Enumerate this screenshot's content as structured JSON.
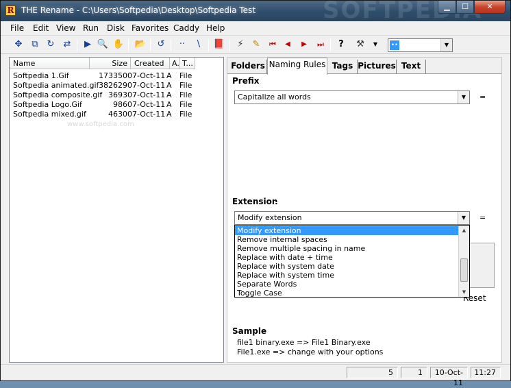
{
  "window": {
    "title": "THE Rename - C:\\Users\\Softpedia\\Desktop\\Softpedia Test",
    "icon_letter": "R",
    "watermark": "SOFTPEDIA",
    "controls": {
      "minimize": "▁",
      "maximize": "☐",
      "close": "✕"
    }
  },
  "menu": [
    "File",
    "Edit",
    "View",
    "Run",
    "Disk",
    "Favorites",
    "Caddy",
    "Help"
  ],
  "toolbar": {
    "icons": [
      "move-icon",
      "copy-icon",
      "refresh-icon",
      "toggle-icon",
      "run-icon",
      "preview-icon",
      "hand-icon",
      "open-folder-icon",
      "undo-icon",
      "dots-icon",
      "slash-icon",
      "book-icon",
      "wand-icon",
      "eraser-icon",
      "first-icon",
      "prev-icon",
      "next-icon",
      "last-icon",
      "help-icon",
      "tools-icon"
    ],
    "glyphs": [
      "✥",
      "⧉",
      "↻",
      "⇄",
      "▶",
      "🔍",
      "✋",
      "📂",
      "↺",
      "··",
      "\\",
      "📕",
      "⚡",
      "✎",
      "⏮",
      "◀",
      "▶",
      "⏭",
      "?",
      "⚒"
    ],
    "combo_swatch": "••"
  },
  "filelist": {
    "columns": [
      "Name",
      "Size",
      "Created",
      "A..",
      "T..."
    ],
    "rows": [
      {
        "name": "Softpedia 1.Gif",
        "size": "173350",
        "created": "07-Oct-11",
        "attr": "A",
        "type": "File"
      },
      {
        "name": "Softpedia animated.gif",
        "size": "382629",
        "created": "07-Oct-11",
        "attr": "A",
        "type": "File"
      },
      {
        "name": "Softpedia composite.gif",
        "size": "3693",
        "created": "07-Oct-11",
        "attr": "A",
        "type": "File"
      },
      {
        "name": "Softpedia Logo.Gif",
        "size": "986",
        "created": "07-Oct-11",
        "attr": "A",
        "type": "File"
      },
      {
        "name": "Softpedia mixed.gif",
        "size": "4630",
        "created": "07-Oct-11",
        "attr": "A",
        "type": "File"
      }
    ],
    "watermark": "www.softpedia.com"
  },
  "tabs": [
    {
      "label": "Folders",
      "active": false
    },
    {
      "label": "Naming Rules",
      "active": true
    },
    {
      "label": "Tags",
      "active": false
    },
    {
      "label": "Pictures",
      "active": false
    },
    {
      "label": "Text",
      "active": false
    }
  ],
  "prefix": {
    "label": "Prefix",
    "value": "Capitalize all words",
    "equals": "="
  },
  "extension": {
    "label": "Extension",
    "value": "Modify extension",
    "equals": "=",
    "options": [
      "Modify extension",
      "Remove internal spaces",
      "Remove multiple spacing in name",
      "Replace with date + time",
      "Replace with system date",
      "Replace with system time",
      "Separate Words",
      "Toggle Case"
    ],
    "selected_index": 0
  },
  "reset_label": "Reset",
  "sample": {
    "label": "Sample",
    "lines": [
      "file1 binary.exe => File1 Binary.exe",
      "File1.exe => change with your options"
    ]
  },
  "status": [
    "5",
    "1",
    "10-Oct-11",
    "11:27"
  ],
  "colors": {
    "selection": "#3399ff",
    "titlebar": "#2f4d6b",
    "close": "#c7462d"
  }
}
